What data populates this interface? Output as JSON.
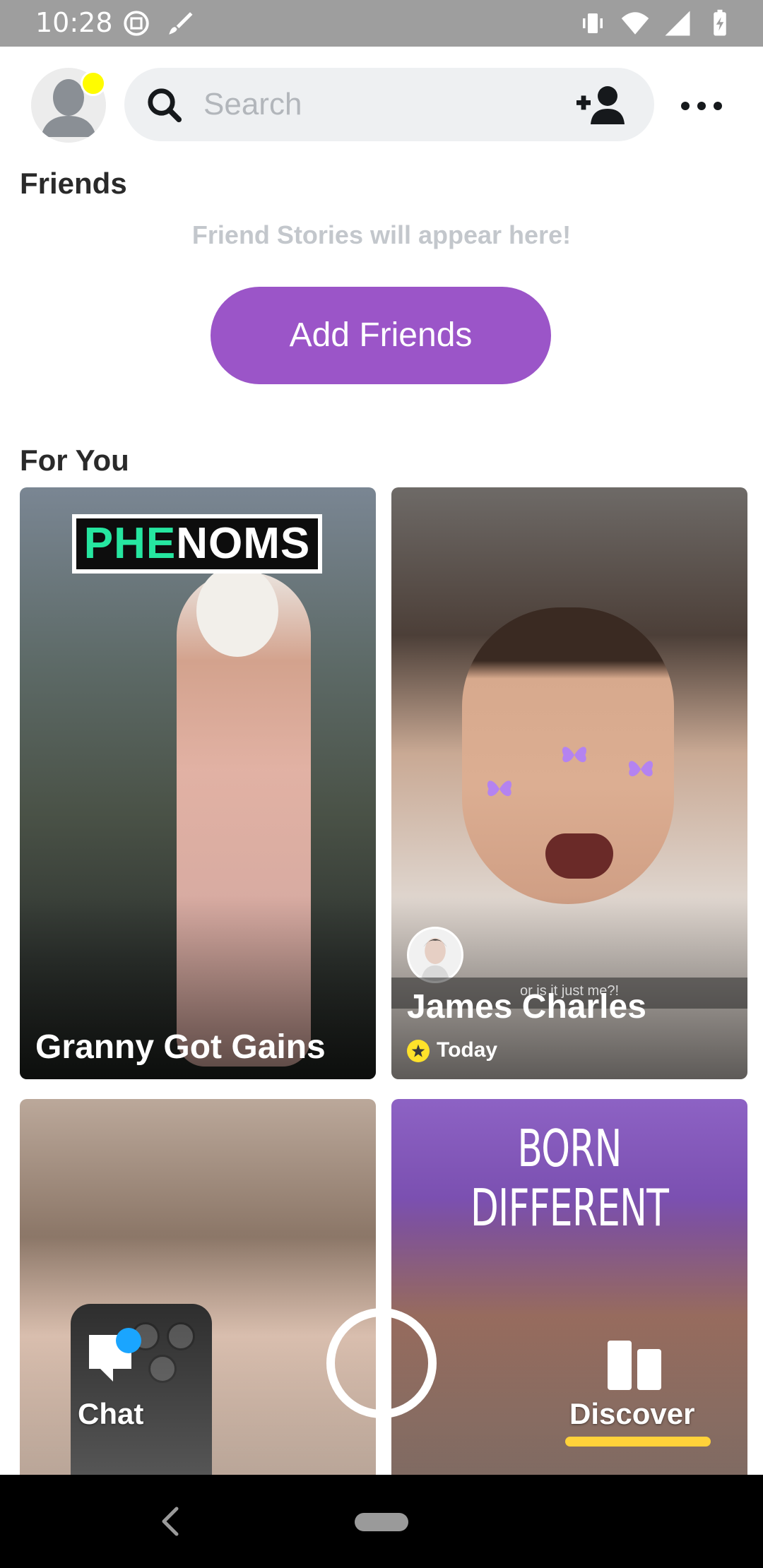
{
  "status_bar": {
    "time": "10:28"
  },
  "header": {
    "search_placeholder": "Search"
  },
  "friends": {
    "title": "Friends",
    "empty_message": "Friend Stories will appear here!",
    "add_friends_label": "Add Friends"
  },
  "for_you": {
    "title": "For You",
    "cards": [
      {
        "logo_part1": "PHE",
        "logo_part2": "NOMS",
        "title": "Granny Got Gains"
      },
      {
        "caption": "or is it just me?!",
        "title": "James Charles",
        "subtitle": "Today"
      },
      {
        "title": ""
      },
      {
        "title": "BORN DIFFERENT"
      }
    ]
  },
  "bottom_nav": {
    "chat_label": "Chat",
    "discover_label": "Discover"
  },
  "colors": {
    "accent_purple": "#9b55c8",
    "snap_yellow": "#fffc00",
    "chat_badge": "#1aa5ff",
    "discover_underline": "#ffd23a"
  },
  "icons": [
    "avatar-icon",
    "search-icon",
    "add-friend-icon",
    "more-icon",
    "chat-icon",
    "camera-icon",
    "discover-icon",
    "back-icon",
    "home-icon",
    "star-icon",
    "butterfly-icon"
  ]
}
